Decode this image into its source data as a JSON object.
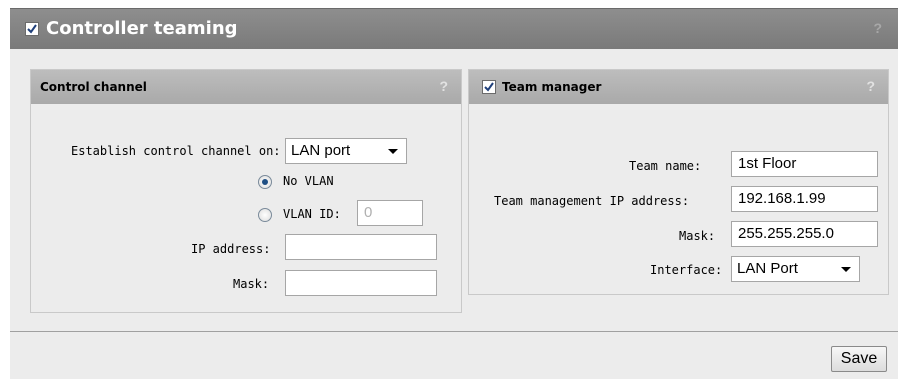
{
  "page": {
    "title": "Controller teaming",
    "enabled": true,
    "help": "?"
  },
  "control_channel": {
    "title": "Control channel",
    "help": "?",
    "establish_label": "Establish control channel on:",
    "establish_value": "LAN port",
    "no_vlan_label": "No VLAN",
    "no_vlan_selected": true,
    "vlan_id_label": "VLAN ID:",
    "vlan_id_placeholder": "0",
    "vlan_id_selected": false,
    "ip_address_label": "IP address:",
    "ip_address_value": "",
    "mask_label": "Mask:",
    "mask_value": ""
  },
  "team_manager": {
    "title": "Team manager",
    "enabled": true,
    "help": "?",
    "team_name_label": "Team name:",
    "team_name_value": "1st Floor",
    "mgmt_ip_label": "Team management IP address:",
    "mgmt_ip_value": "192.168.1.99",
    "mask_label": "Mask:",
    "mask_value": "255.255.255.0",
    "interface_label": "Interface:",
    "interface_value": "LAN Port"
  },
  "footer": {
    "save_label": "Save"
  },
  "colors": {
    "header_bg": "#858585",
    "panel_head_bg": "#b3b3b3",
    "content_bg": "#ececec",
    "radio_dot": "#1f4f84"
  }
}
